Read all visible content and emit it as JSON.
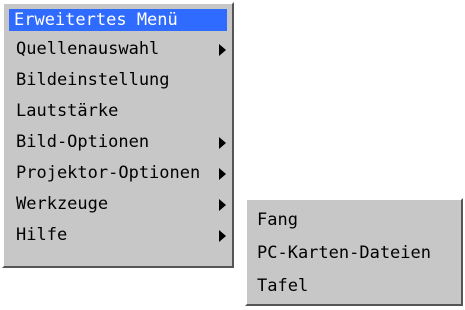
{
  "menu": {
    "title": "Erweitertes Menü",
    "items": [
      {
        "label": "Quellenauswahl",
        "has_submenu": true
      },
      {
        "label": "Bildeinstellung",
        "has_submenu": false
      },
      {
        "label": "Lautstärke",
        "has_submenu": false
      },
      {
        "label": "Bild-Optionen",
        "has_submenu": true
      },
      {
        "label": "Projektor-Optionen",
        "has_submenu": true
      },
      {
        "label": "Werkzeuge",
        "has_submenu": true
      },
      {
        "label": "Hilfe",
        "has_submenu": true
      }
    ]
  },
  "submenu": {
    "items": [
      {
        "label": "Fang"
      },
      {
        "label": "PC-Karten-Dateien"
      },
      {
        "label": "Tafel"
      }
    ]
  },
  "colors": {
    "menu_bg": "#c7c7c7",
    "title_bg": "#2f6bff",
    "title_text": "#ffffff"
  },
  "icons": {
    "submenu_arrow": "triangle-right-icon"
  }
}
